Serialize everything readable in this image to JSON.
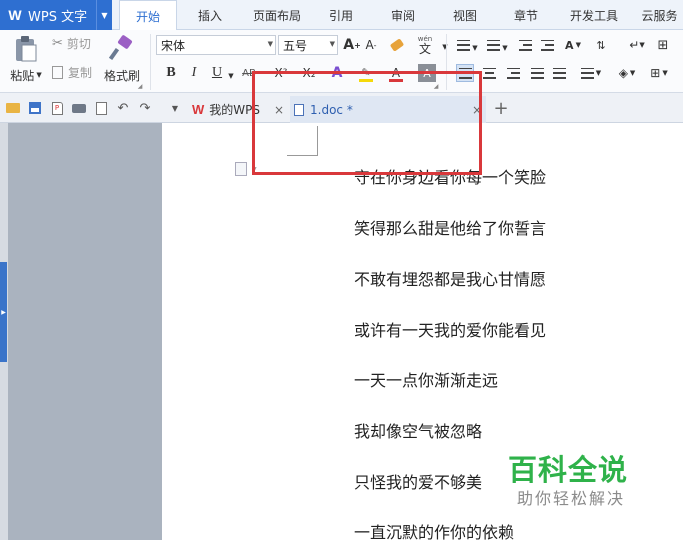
{
  "app": {
    "title": "WPS 文字"
  },
  "menu_tabs": [
    {
      "label": "开始",
      "active": true
    },
    {
      "label": "插入"
    },
    {
      "label": "页面布局"
    },
    {
      "label": "引用"
    },
    {
      "label": "审阅"
    },
    {
      "label": "视图"
    },
    {
      "label": "章节"
    },
    {
      "label": "开发工具"
    },
    {
      "label": "云服务"
    }
  ],
  "ribbon": {
    "paste_label": "粘贴",
    "cut_label": "剪切",
    "copy_label": "复制",
    "format_painter_label": "格式刷",
    "font_name": "宋体",
    "font_size": "五号",
    "phonetic_label": "wén",
    "phonetic_char": "文",
    "grow_font_glyph": "A",
    "shrink_font_glyph": "A",
    "bold_glyph": "B",
    "italic_glyph": "I",
    "underline_glyph": "U",
    "strike_glyph": "AB",
    "superscript_glyph": "X²",
    "subscript_glyph": "X₂",
    "char_border_glyph": "A"
  },
  "doc_tabs": [
    {
      "label": "我的WPS",
      "active": false
    },
    {
      "label": "1.doc *",
      "active": true
    }
  ],
  "document": {
    "lines": [
      "守在你身边看你每一个笑脸",
      "笑得那么甜是他给了你誓言",
      "不敢有埋怨都是我心甘情愿",
      "或许有一天我的爱你能看见",
      "一天一点你渐渐走远",
      "我却像空气被忽略",
      "只怪我的爱不够美",
      "一直沉默的作你的依赖"
    ]
  },
  "watermark": {
    "main": "百科全说",
    "sub": "助你轻松解决"
  },
  "colors": {
    "accent": "#2e6fd1",
    "highlight_box": "#d9383b",
    "watermark_green": "#2fb24a",
    "font_color_red": "#d9383b",
    "highlighter_yellow": "#f5d90a"
  }
}
